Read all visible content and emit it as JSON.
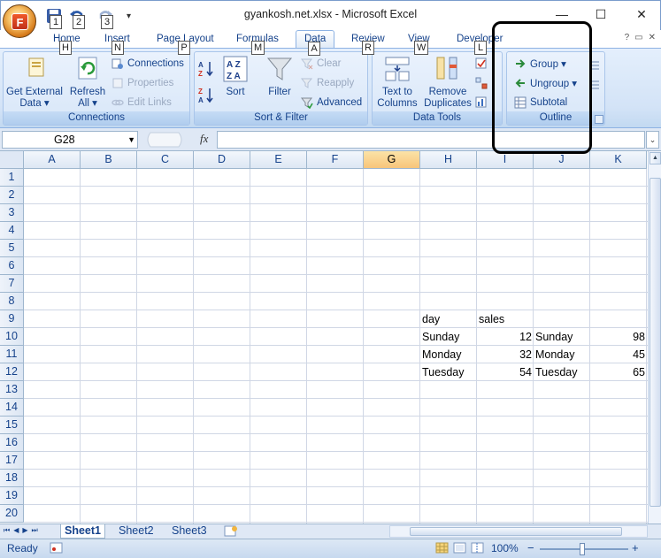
{
  "window": {
    "title": "gyankosh.net.xlsx - Microsoft Excel",
    "minimize_glyph": "—",
    "maximize_glyph": "☐",
    "close_glyph": "✕"
  },
  "office_button": {
    "letter": "F"
  },
  "qat": {
    "items": [
      {
        "icon": "save-icon",
        "keytip": "1"
      },
      {
        "icon": "undo-icon",
        "keytip": "2"
      },
      {
        "icon": "redo-icon",
        "keytip": "3"
      }
    ],
    "customize_glyph": "▾"
  },
  "tabs": [
    {
      "label": "Home",
      "keytip": "H"
    },
    {
      "label": "Insert",
      "keytip": "N"
    },
    {
      "label": "Page Layout",
      "keytip": "P"
    },
    {
      "label": "Formulas",
      "keytip": "M"
    },
    {
      "label": "Data",
      "keytip": "A",
      "active": true
    },
    {
      "label": "Review",
      "keytip": "R"
    },
    {
      "label": "View",
      "keytip": "W"
    },
    {
      "label": "Developer",
      "keytip": "L"
    }
  ],
  "ribbon": {
    "connections_group": {
      "label": "Connections",
      "get_external_data": "Get External",
      "get_external_data_2": "Data ▾",
      "refresh": "Refresh",
      "refresh_2": "All ▾",
      "connections": "Connections",
      "properties": "Properties",
      "edit_links": "Edit Links"
    },
    "sort_filter_group": {
      "label": "Sort & Filter",
      "sort": "Sort",
      "filter": "Filter",
      "clear": "Clear",
      "reapply": "Reapply",
      "advanced": "Advanced"
    },
    "data_tools_group": {
      "label": "Data Tools",
      "text_to_columns": "Text to",
      "text_to_columns_2": "Columns",
      "remove_duplicates": "Remove",
      "remove_duplicates_2": "Duplicates"
    },
    "outline_group": {
      "label": "Outline",
      "group": "Group ▾",
      "ungroup": "Ungroup ▾",
      "subtotal": "Subtotal"
    }
  },
  "formula_bar": {
    "name_box": "G28",
    "fx": "fx",
    "formula": ""
  },
  "sheet": {
    "columns": [
      "A",
      "B",
      "C",
      "D",
      "E",
      "F",
      "G",
      "H",
      "I",
      "J",
      "K"
    ],
    "selected_column": "G",
    "rows": [
      "1",
      "2",
      "3",
      "4",
      "5",
      "6",
      "7",
      "8",
      "9",
      "10",
      "11",
      "12",
      "13",
      "14",
      "15",
      "16",
      "17",
      "18",
      "19",
      "20"
    ],
    "cells": {
      "H9": "day",
      "I9": "sales",
      "H10": "Sunday",
      "I10": "12",
      "J10": "Sunday",
      "K10": "98",
      "H11": "Monday",
      "I11": "32",
      "J11": "Monday",
      "K11": "45",
      "H12": "Tuesday",
      "I12": "54",
      "J12": "Tuesday",
      "K12": "65"
    }
  },
  "sheet_tabs": [
    "Sheet1",
    "Sheet2",
    "Sheet3"
  ],
  "active_sheet": "Sheet1",
  "status": {
    "ready": "Ready",
    "zoom": "100%",
    "zoom_out": "−",
    "zoom_in": "+"
  }
}
